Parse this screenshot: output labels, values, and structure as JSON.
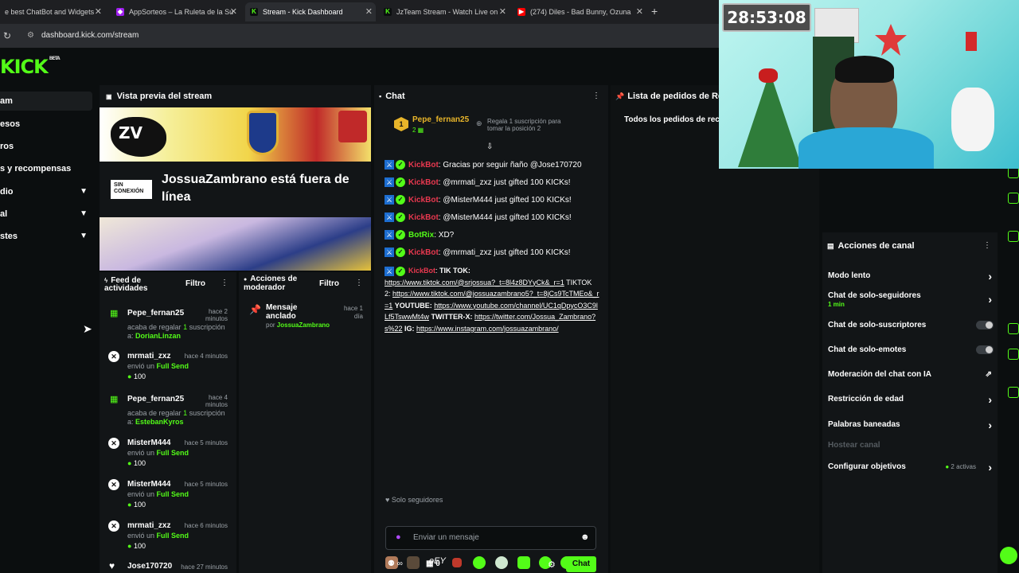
{
  "browser": {
    "tabs": [
      {
        "title": "e best ChatBot and Widgets",
        "active": false
      },
      {
        "title": "AppSorteos – La Ruleta de la Su",
        "active": false
      },
      {
        "title": "Stream - Kick Dashboard",
        "active": true
      },
      {
        "title": "JzTeam Stream - Watch Live on",
        "active": false
      },
      {
        "title": "(274) Diles - Bad Bunny, Ozuna",
        "active": false
      }
    ],
    "new_tab": "+",
    "url": "dashboard.kick.com/stream"
  },
  "app": {
    "logo": "KICK",
    "logo_tag": "BETA",
    "sidebar": [
      {
        "label": "am",
        "selected": true,
        "chevron": false
      },
      {
        "label": "esos",
        "selected": false,
        "chevron": false
      },
      {
        "label": "ros",
        "selected": false,
        "chevron": false
      },
      {
        "label": "s y recompensas",
        "selected": false,
        "chevron": false
      },
      {
        "label": "dio",
        "selected": false,
        "chevron": true
      },
      {
        "label": "al",
        "selected": false,
        "chevron": true
      },
      {
        "label": "stes",
        "selected": false,
        "chevron": true
      }
    ]
  },
  "preview": {
    "title": "Vista previa del stream",
    "offline_badge": "SIN CONEXIÓN",
    "offline_text": "JossuaZambrano está fuera de línea"
  },
  "feed": {
    "title": "Feed de actividades",
    "filter": "Filtro",
    "items": [
      {
        "name": "Pepe_fernan25",
        "time": "hace 2 minutos",
        "line1": "acaba de regalar",
        "count": "1",
        "line2": "suscripción",
        "to_prefix": "a:",
        "to": "DorianLinzan",
        "type": "gift"
      },
      {
        "name": "mrmati_zxz",
        "time": "hace 4 minutos",
        "line1": "envió un",
        "item": "Full Send",
        "amount": "100",
        "type": "kicks"
      },
      {
        "name": "Pepe_fernan25",
        "time": "hace 4 minutos",
        "line1": "acaba de regalar",
        "count": "1",
        "line2": "suscripción",
        "to_prefix": "a:",
        "to": "EstebanKyros",
        "type": "gift"
      },
      {
        "name": "MisterM444",
        "time": "hace 5 minutos",
        "line1": "envió un",
        "item": "Full Send",
        "amount": "100",
        "type": "kicks"
      },
      {
        "name": "MisterM444",
        "time": "hace 5 minutos",
        "line1": "envió un",
        "item": "Full Send",
        "amount": "100",
        "type": "kicks"
      },
      {
        "name": "mrmati_zxz",
        "time": "hace 6 minutos",
        "line1": "envió un",
        "item": "Full Send",
        "amount": "100",
        "type": "kicks"
      },
      {
        "name": "Jose170720",
        "time": "hace 27 minutos",
        "type": "follow"
      }
    ]
  },
  "mod": {
    "title": "Acciones de moderador",
    "filter": "Filtro",
    "pinned_title": "Mensaje anclado",
    "pinned_by_prefix": "por",
    "pinned_by": "JossuaZambrano",
    "pinned_time": "hace 1 día"
  },
  "chat": {
    "title": "Chat",
    "top_gifter": "Pepe_fernan25",
    "top_gifter_count": "2",
    "top_gifter_rank": "1",
    "gift_prompt": "Regala 1 suscripción para tomar la posición 2",
    "messages": [
      {
        "user": "KickBot",
        "text": ": Gracias por seguir ñaño @Jose170720"
      },
      {
        "user": "KickBot",
        "text": ": @mrmati_zxz just gifted 100 KICKs!"
      },
      {
        "user": "KickBot",
        "text": ": @MisterM444 just gifted 100 KICKs!"
      },
      {
        "user": "KickBot",
        "text": ": @MisterM444 just gifted 100 KICKs!"
      },
      {
        "user": "BotRix",
        "text": ": XD?"
      },
      {
        "user": "KickBot",
        "text": ": @mrmati_zxz just gifted 100 KICKs!"
      }
    ],
    "long_message": {
      "user": "KickBot",
      "tiktok_label": "TIK TOK:",
      "link1": "https://www.tiktok.com/@srjossua?_t=8l4z8DYyCk&_r=1",
      "tiktok2_label": "TIKTOK 2:",
      "link2": "https://www.tiktok.com/@jossuazambrano5?_t=8jCs9TcTMEo&_r=1",
      "youtube_label": "YOUTUBE:",
      "link3": "https://www.youtube.com/channel/UC1qDpycO3C9lLf5TswwMt4w",
      "twitter_label": "TWITTER-X:",
      "link4": "https://twitter.com/Jossua_Zambrano?s%22",
      "ig_label": "IG:",
      "link5": "https://www.instagram.com/jossuazambrano/"
    },
    "followers_only": "Solo seguidores",
    "input_placeholder": "Enviar un mensaje",
    "points": "∞",
    "gifts": "0",
    "send": "Chat"
  },
  "requests": {
    "title": "Lista de pedidos de Rec",
    "subtitle": "Todos los pedidos de rec"
  },
  "channel_actions": {
    "title": "Acciones de canal",
    "rows": [
      {
        "label": "Modo lento",
        "control": "arrow"
      },
      {
        "label": "Chat de solo-seguidores",
        "sub": "1 min",
        "control": "arrow"
      },
      {
        "label": "Chat de solo-suscriptores",
        "control": "toggle"
      },
      {
        "label": "Chat de solo-emotes",
        "control": "toggle"
      },
      {
        "label": "Moderación del chat con IA",
        "control": "external"
      },
      {
        "label": "Restricción de edad",
        "control": "arrow"
      },
      {
        "label": "Palabras baneadas",
        "control": "arrow"
      },
      {
        "label": "Hostear canal",
        "control": "none",
        "disabled": true
      },
      {
        "label": "Configurar objetivos",
        "status": "2 activas",
        "control": "arrow"
      }
    ]
  },
  "webcam": {
    "timer": "28:53:08"
  },
  "colors": {
    "accent": "#53fc18",
    "kickbot": "#e8384f",
    "panel": "#121517",
    "background": "#0b0e0f"
  }
}
